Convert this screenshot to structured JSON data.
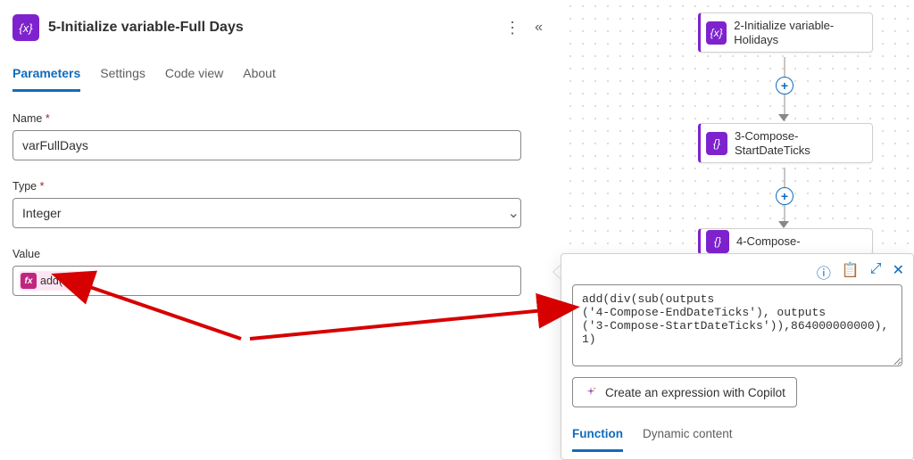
{
  "header": {
    "title": "5-Initialize variable-Full Days"
  },
  "tabs": [
    "Parameters",
    "Settings",
    "Code view",
    "About"
  ],
  "fields": {
    "name_label": "Name",
    "name_value": "varFullDays",
    "type_label": "Type",
    "type_value": "Integer",
    "value_label": "Value",
    "value_token": "add(...)"
  },
  "flow_nodes": {
    "n1": "2-Initialize variable-Holidays",
    "n2": "3-Compose-StartDateTicks",
    "n3": "4-Compose-"
  },
  "flyout": {
    "expression": "add(div(sub(outputs\n('4-Compose-EndDateTicks'), outputs\n('3-Compose-StartDateTicks')),864000000000),\n1)",
    "copilot_label": "Create an expression with Copilot",
    "tabs": [
      "Function",
      "Dynamic content"
    ]
  },
  "icons": {
    "var_glyph": "{x}",
    "compose_glyph": "{}",
    "fx_glyph": "fx",
    "plus": "+",
    "info": "ⓘ",
    "clipboard": "📋",
    "expand": "⤢",
    "close": "✕",
    "chevron": "⌄",
    "kebab": "⋮",
    "collapse": "«"
  }
}
